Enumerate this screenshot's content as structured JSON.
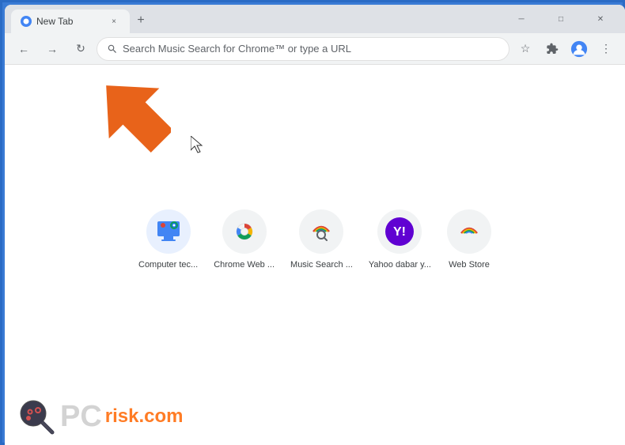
{
  "browser": {
    "tab_title": "New Tab",
    "tab_close_label": "×",
    "new_tab_label": "+",
    "window_controls": {
      "minimize": "─",
      "maximize": "□",
      "close": "✕"
    },
    "address_bar": {
      "placeholder": "Search Music Search for Chrome™ or type a URL"
    },
    "toolbar": {
      "back_icon": "←",
      "forward_icon": "→",
      "reload_icon": "↻",
      "star_icon": "☆",
      "extension_icon": "⚡",
      "profile_icon": "👤",
      "menu_icon": "⋮"
    }
  },
  "shortcuts": [
    {
      "label": "Computer tec...",
      "icon_name": "computer-tech-icon",
      "color": "#e8f0fe"
    },
    {
      "label": "Chrome Web ...",
      "icon_name": "chrome-web-icon",
      "color": "#f1f3f4"
    },
    {
      "label": "Music Search ...",
      "icon_name": "music-search-icon",
      "color": "#f1f3f4"
    },
    {
      "label": "Yahoo dabar y...",
      "icon_name": "yahoo-icon",
      "color": "#f1f3f4"
    },
    {
      "label": "Web Store",
      "icon_name": "web-store-icon",
      "color": "#f1f3f4"
    }
  ],
  "watermark": {
    "pc_text": "PC",
    "risk_text": "risk",
    "dotcom_text": ".com"
  },
  "colors": {
    "orange_arrow": "#e8631a",
    "chrome_red": "#db4437",
    "chrome_yellow": "#f4b400",
    "chrome_green": "#0f9d58",
    "chrome_blue": "#4285f4",
    "yahoo_purple": "#6001d2"
  }
}
